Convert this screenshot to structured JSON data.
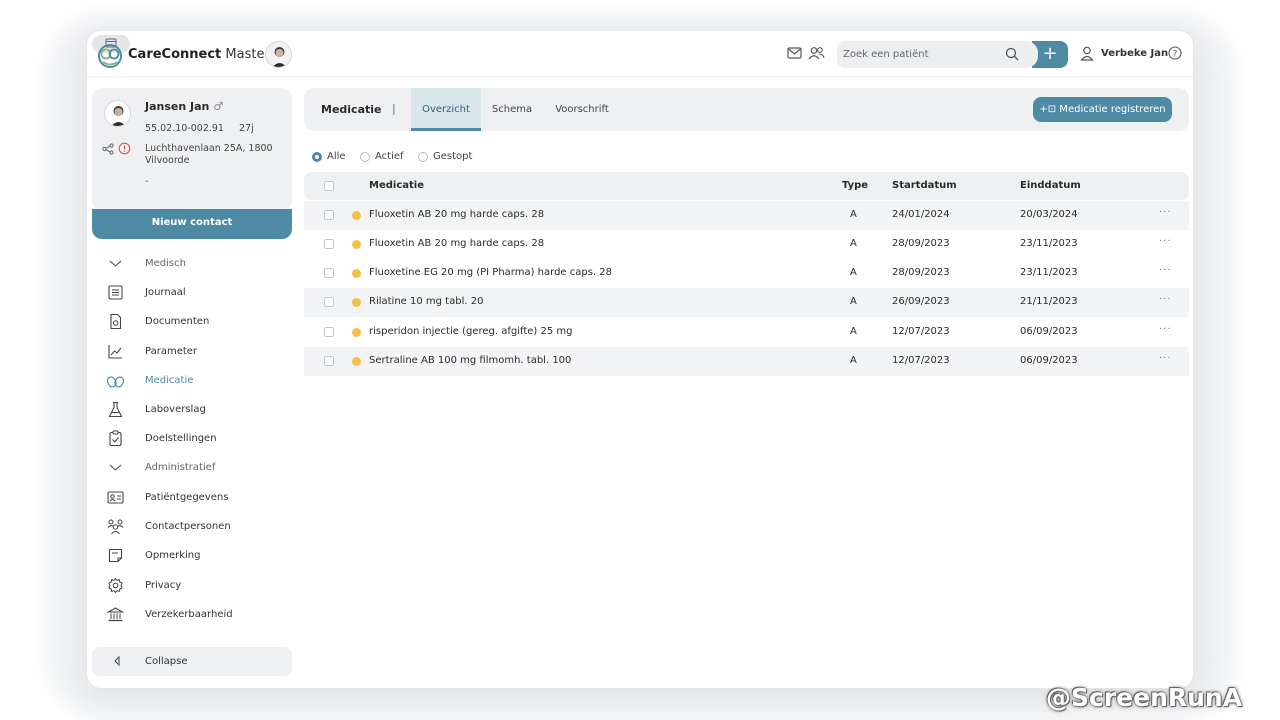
{
  "app": {
    "name_bold": "CareConnect",
    "name_light": " Master"
  },
  "header": {
    "search_placeholder": "Zoek een patiënt",
    "add_label": "+",
    "user_name": "Verbeke Jan",
    "icons": [
      "mail-icon",
      "people-icon",
      "search-icon",
      "user-icon",
      "help-icon"
    ]
  },
  "patient": {
    "name": "Jansen Jan",
    "gender_symbol": "♂",
    "id": "55.02.10-002.91",
    "age": "27j",
    "address": "Luchthavenlaan 25A, 1800 Vilvoorde",
    "extra": "-",
    "new_contact_label": "Nieuw contact"
  },
  "nav": {
    "items": [
      {
        "label": "Medisch",
        "icon": "chevron-down-icon",
        "type": "group"
      },
      {
        "label": "Journaal",
        "icon": "journal-icon"
      },
      {
        "label": "Documenten",
        "icon": "document-icon"
      },
      {
        "label": "Parameter",
        "icon": "chart-line-icon"
      },
      {
        "label": "Medicatie",
        "icon": "pills-icon",
        "active": true
      },
      {
        "label": "Laboverslag",
        "icon": "flask-icon"
      },
      {
        "label": "Doelstellingen",
        "icon": "clipboard-check-icon"
      },
      {
        "label": "Administratief",
        "icon": "chevron-down-icon",
        "type": "group"
      },
      {
        "label": "Patiëntgegevens",
        "icon": "id-card-icon"
      },
      {
        "label": "Contactpersonen",
        "icon": "contacts-icon"
      },
      {
        "label": "Opmerking",
        "icon": "note-icon"
      },
      {
        "label": "Privacy",
        "icon": "gear-icon"
      },
      {
        "label": "Verzekerbaarheid",
        "icon": "bank-icon"
      }
    ],
    "collapse_label": "Collapse"
  },
  "main": {
    "section_title": "Medicatie",
    "separator": "|",
    "tabs": [
      {
        "label": "Overzicht",
        "active": true
      },
      {
        "label": "Schema"
      },
      {
        "label": "Voorschrift"
      }
    ],
    "register_label": "+⊡ Medicatie registreren",
    "filters": [
      {
        "label": "Alle",
        "checked": true
      },
      {
        "label": "Actief"
      },
      {
        "label": "Gestopt"
      }
    ]
  },
  "table": {
    "headers": {
      "medication": "Medicatie",
      "type": "Type",
      "start": "Startdatum",
      "end": "Einddatum"
    },
    "rows": [
      {
        "medication": "Fluoxetin AB 20 mg harde caps. 28",
        "type": "A",
        "start": "24/01/2024",
        "end": "20/03/2024",
        "status_color": "#f5c04a"
      },
      {
        "medication": "Fluoxetin AB 20 mg harde caps. 28",
        "type": "A",
        "start": "28/09/2023",
        "end": "23/11/2023",
        "status_color": "#f5c04a"
      },
      {
        "medication": "Fluoxetine EG 20 mg (PI Pharma) harde caps. 28",
        "type": "A",
        "start": "28/09/2023",
        "end": "23/11/2023",
        "status_color": "#f5c04a"
      },
      {
        "medication": "Rilatine 10 mg tabl. 20",
        "type": "A",
        "start": "26/09/2023",
        "end": "21/11/2023",
        "status_color": "#f5c04a"
      },
      {
        "medication": "risperidon injectie (gereg. afgifte) 25 mg",
        "type": "A",
        "start": "12/07/2023",
        "end": "06/09/2023",
        "status_color": "#f5c04a"
      },
      {
        "medication": "Sertraline AB 100 mg filmomh. tabl. 100",
        "type": "A",
        "start": "12/07/2023",
        "end": "06/09/2023",
        "status_color": "#f5c04a"
      }
    ],
    "more_label": "···"
  },
  "watermark": "@ScreenRunA",
  "colors": {
    "accent": "#4f8aa5",
    "status_dot": "#f5c04a",
    "panel": "#eef0f2"
  }
}
